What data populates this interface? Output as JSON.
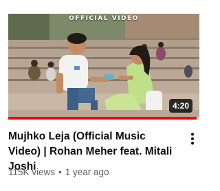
{
  "video": {
    "thumbnail_caption": "OFFICIAL VIDEO",
    "duration": "4:20",
    "watched_progress": 0.985,
    "title": "Mujhko Leja (Official Music Video) | Rohan Meher feat. Mitali Joshi",
    "views": "115K views",
    "separator": "•",
    "age": "1 year ago"
  },
  "icons": {
    "more": "more-vertical-icon"
  },
  "colors": {
    "title": "#0f0f0f",
    "meta": "#606060",
    "progress": "#ff0000",
    "duration_badge": "#000000"
  }
}
